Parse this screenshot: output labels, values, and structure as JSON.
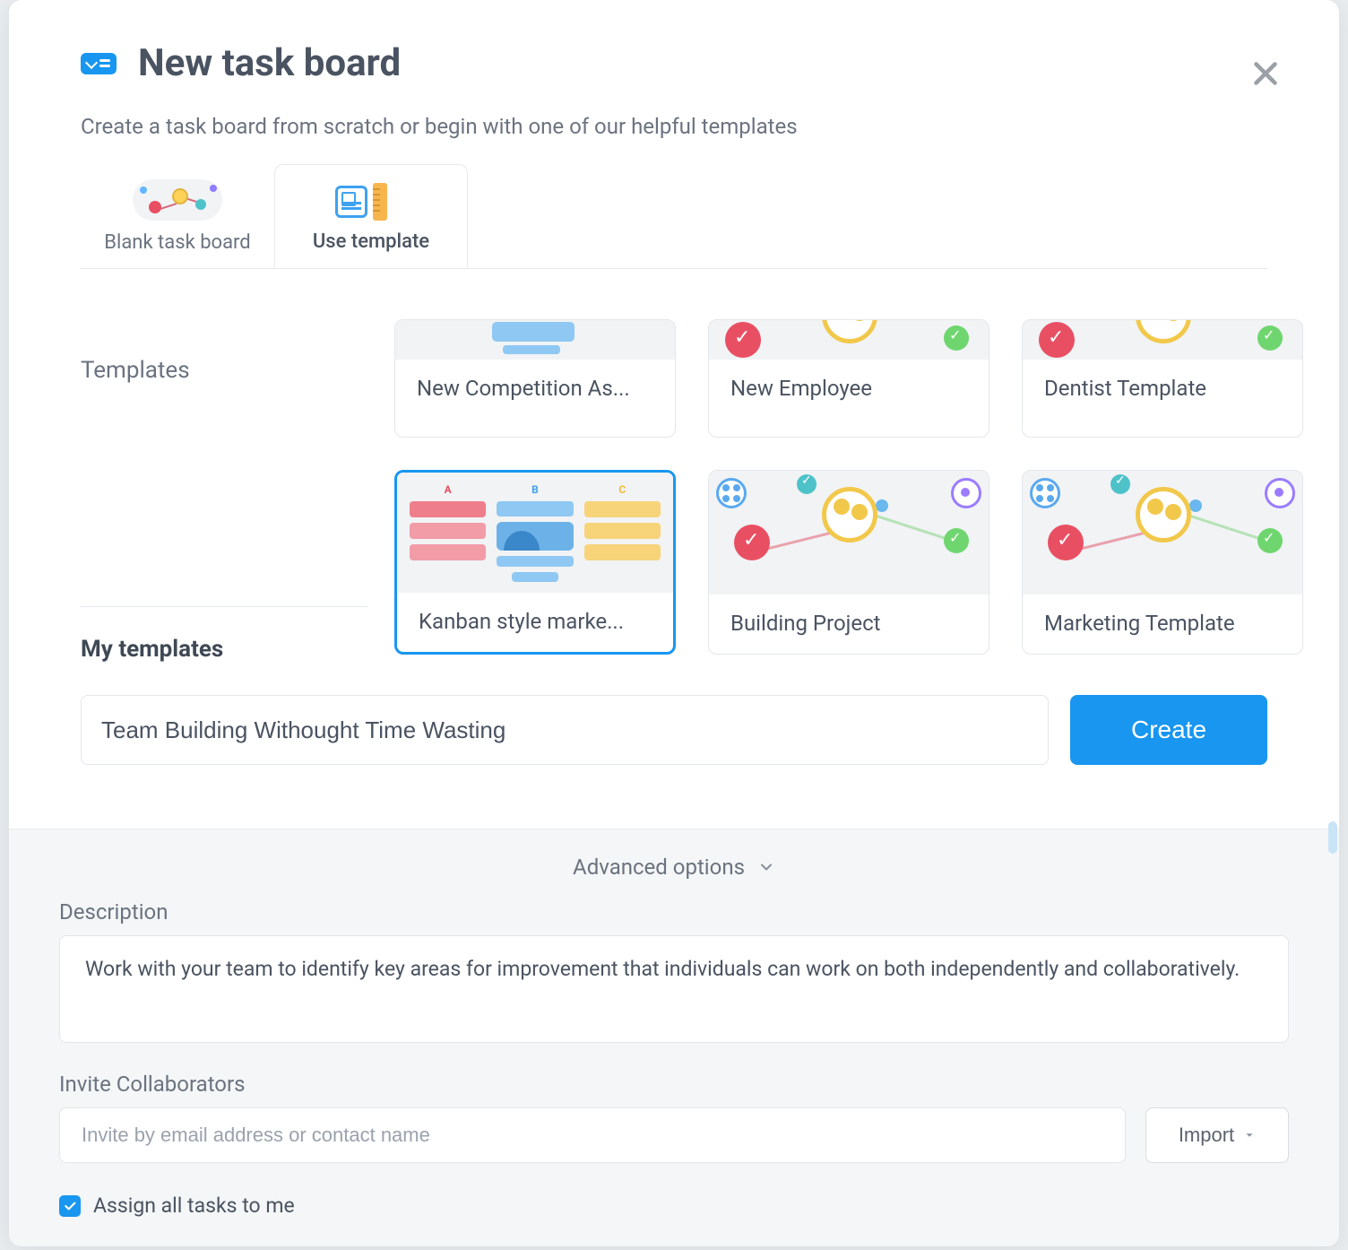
{
  "header": {
    "title": "New task board",
    "subtitle": "Create a task board from scratch or begin with one of our helpful templates"
  },
  "tabs": {
    "blank": "Blank task board",
    "use_template": "Use template"
  },
  "sections": {
    "templates": "Templates",
    "my_templates": "My templates"
  },
  "templates_row1": [
    {
      "name": "New Competition As..."
    },
    {
      "name": "New Employee"
    },
    {
      "name": "Dentist Template"
    }
  ],
  "templates_row2": [
    {
      "name": "Kanban style marke..."
    },
    {
      "name": "Building Project"
    },
    {
      "name": "Marketing Template"
    }
  ],
  "name_input": {
    "value": "Team Building Withought Time Wasting"
  },
  "create_label": "Create",
  "advanced": {
    "toggle": "Advanced options",
    "description_label": "Description",
    "description_value": "Work with your team to identify key areas for improvement that individuals can work on both independently and collaboratively.",
    "invite_label": "Invite Collaborators",
    "invite_placeholder": "Invite by email address or contact name",
    "import_label": "Import",
    "assign_label": "Assign all tasks to me",
    "assign_checked": true
  }
}
